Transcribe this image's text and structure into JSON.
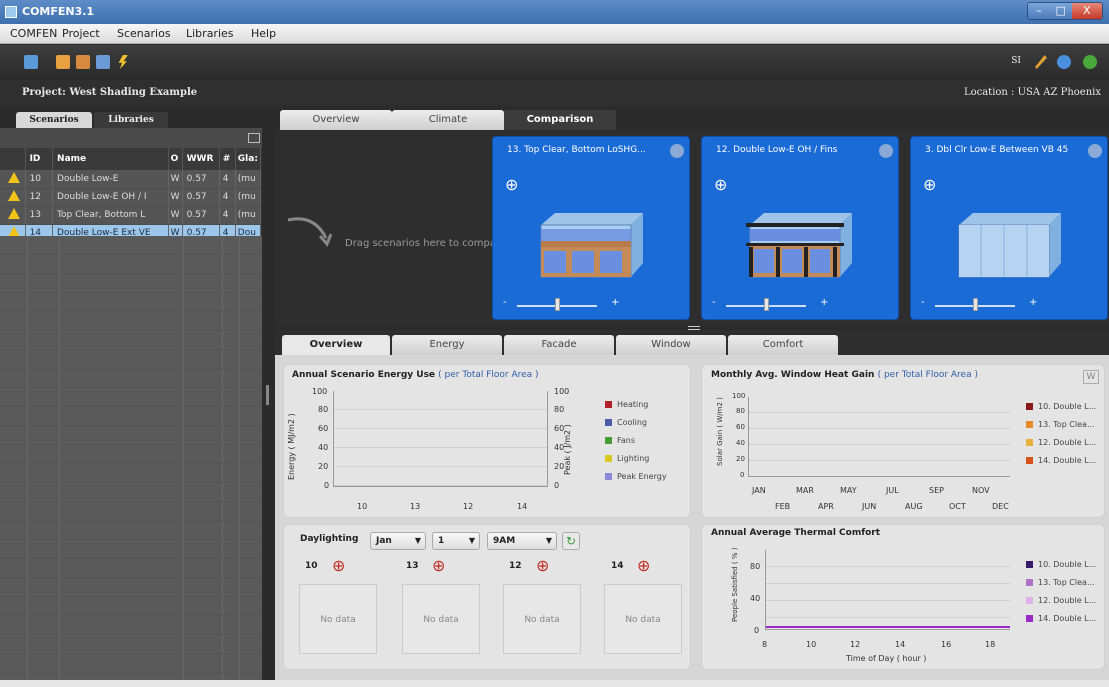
{
  "window": {
    "title": "COMFEN3.1",
    "minimize": "–",
    "maximize": "□",
    "close": "X"
  },
  "menu": [
    "COMFEN",
    "Project",
    "Scenarios",
    "Libraries",
    "Help"
  ],
  "toolbar": {
    "units": "SI"
  },
  "project": {
    "label": "Project: West Shading Example",
    "location": "Location :   USA AZ Phoenix"
  },
  "left_tabs": {
    "scenarios": "Scenarios",
    "libraries": "Libraries"
  },
  "scenario_table": {
    "headers": [
      "ID",
      "Name",
      "O",
      "WWR",
      "#",
      "Gla:"
    ],
    "rows": [
      {
        "id": "10",
        "name": "Double Low-E",
        "o": "W",
        "wwr": "0.57",
        "n": "4",
        "gla": "(mu"
      },
      {
        "id": "12",
        "name": "Double Low-E OH / I",
        "o": "W",
        "wwr": "0.57",
        "n": "4",
        "gla": "(mu"
      },
      {
        "id": "13",
        "name": "Top Clear, Bottom L",
        "o": "W",
        "wwr": "0.57",
        "n": "4",
        "gla": "(mu"
      },
      {
        "id": "14",
        "name": "Double Low-E Ext VE",
        "o": "W",
        "wwr": "0.57",
        "n": "4",
        "gla": "Dou"
      }
    ]
  },
  "top_tabs": [
    "Overview",
    "Climate",
    "Comparison"
  ],
  "compare": {
    "drag_text": "Drag scenarios here to compare.",
    "cards": [
      {
        "title": "13. Top Clear, Bottom LoSHG...",
        "minus": "-",
        "plus": "+"
      },
      {
        "title": "12. Double Low-E OH / Fins",
        "minus": "-",
        "plus": "+"
      },
      {
        "title": "3. Dbl Clr Low-E Between VB 45",
        "minus": "-",
        "plus": "+"
      }
    ]
  },
  "bottom_tabs": [
    "Overview",
    "Energy",
    "Facade",
    "Window",
    "Comfort"
  ],
  "energy_panel": {
    "title": "Annual Scenario Energy Use",
    "subtitle": "( per Total Floor Area )",
    "ylabel": "Energy ( MJ/m2 )",
    "y2label": "Peak ( J/m2 )",
    "yticks": [
      "100",
      "80",
      "60",
      "40",
      "20",
      "0"
    ],
    "xticks": [
      "10",
      "13",
      "12",
      "14"
    ],
    "legend": [
      {
        "label": "Heating",
        "color": "#b0202a"
      },
      {
        "label": "Cooling",
        "color": "#4a5ca8"
      },
      {
        "label": "Fans",
        "color": "#4a9a3a"
      },
      {
        "label": "Lighting",
        "color": "#d8c820"
      },
      {
        "label": "Peak Energy",
        "color": "#8a8ad8"
      }
    ]
  },
  "heatgain_panel": {
    "title": "Monthly Avg. Window Heat Gain",
    "subtitle": "( per Total Floor Area )",
    "button": "W",
    "ylabel": "Solar Gain ( W/m2 )",
    "yticks": [
      "100",
      "80",
      "60",
      "40",
      "20",
      "0"
    ],
    "xticks_top": [
      "JAN",
      "MAR",
      "MAY",
      "JUL",
      "SEP",
      "NOV"
    ],
    "xticks_bottom": [
      "FEB",
      "APR",
      "JUN",
      "AUG",
      "OCT",
      "DEC"
    ],
    "legend": [
      {
        "label": "10. Double L...",
        "color": "#8a1a1a"
      },
      {
        "label": "13. Top Clea...",
        "color": "#e88a2a"
      },
      {
        "label": "12. Double L...",
        "color": "#e8b03a"
      },
      {
        "label": "14. Double L...",
        "color": "#d8501a"
      }
    ]
  },
  "daylighting": {
    "title": "Daylighting",
    "month": "Jan",
    "day": "1",
    "time": "9AM",
    "scenarios": [
      {
        "id": "10",
        "status": "No data"
      },
      {
        "id": "13",
        "status": "No data"
      },
      {
        "id": "12",
        "status": "No data"
      },
      {
        "id": "14",
        "status": "No data"
      }
    ]
  },
  "comfort_panel": {
    "title": "Annual Average Thermal Comfort",
    "ylabel": "People Satisfied ( % )",
    "xlabel": "Time of Day ( hour )",
    "yticks": [
      "80",
      "40",
      "0"
    ],
    "xticks": [
      "8",
      "10",
      "12",
      "14",
      "16",
      "18"
    ],
    "legend": [
      {
        "label": "10. Double L...",
        "color": "#3a1a6a"
      },
      {
        "label": "13. Top Clea...",
        "color": "#b070c8"
      },
      {
        "label": "12. Double L...",
        "color": "#e0b0e8"
      },
      {
        "label": "14. Double L...",
        "color": "#9a2ac8"
      }
    ]
  }
}
